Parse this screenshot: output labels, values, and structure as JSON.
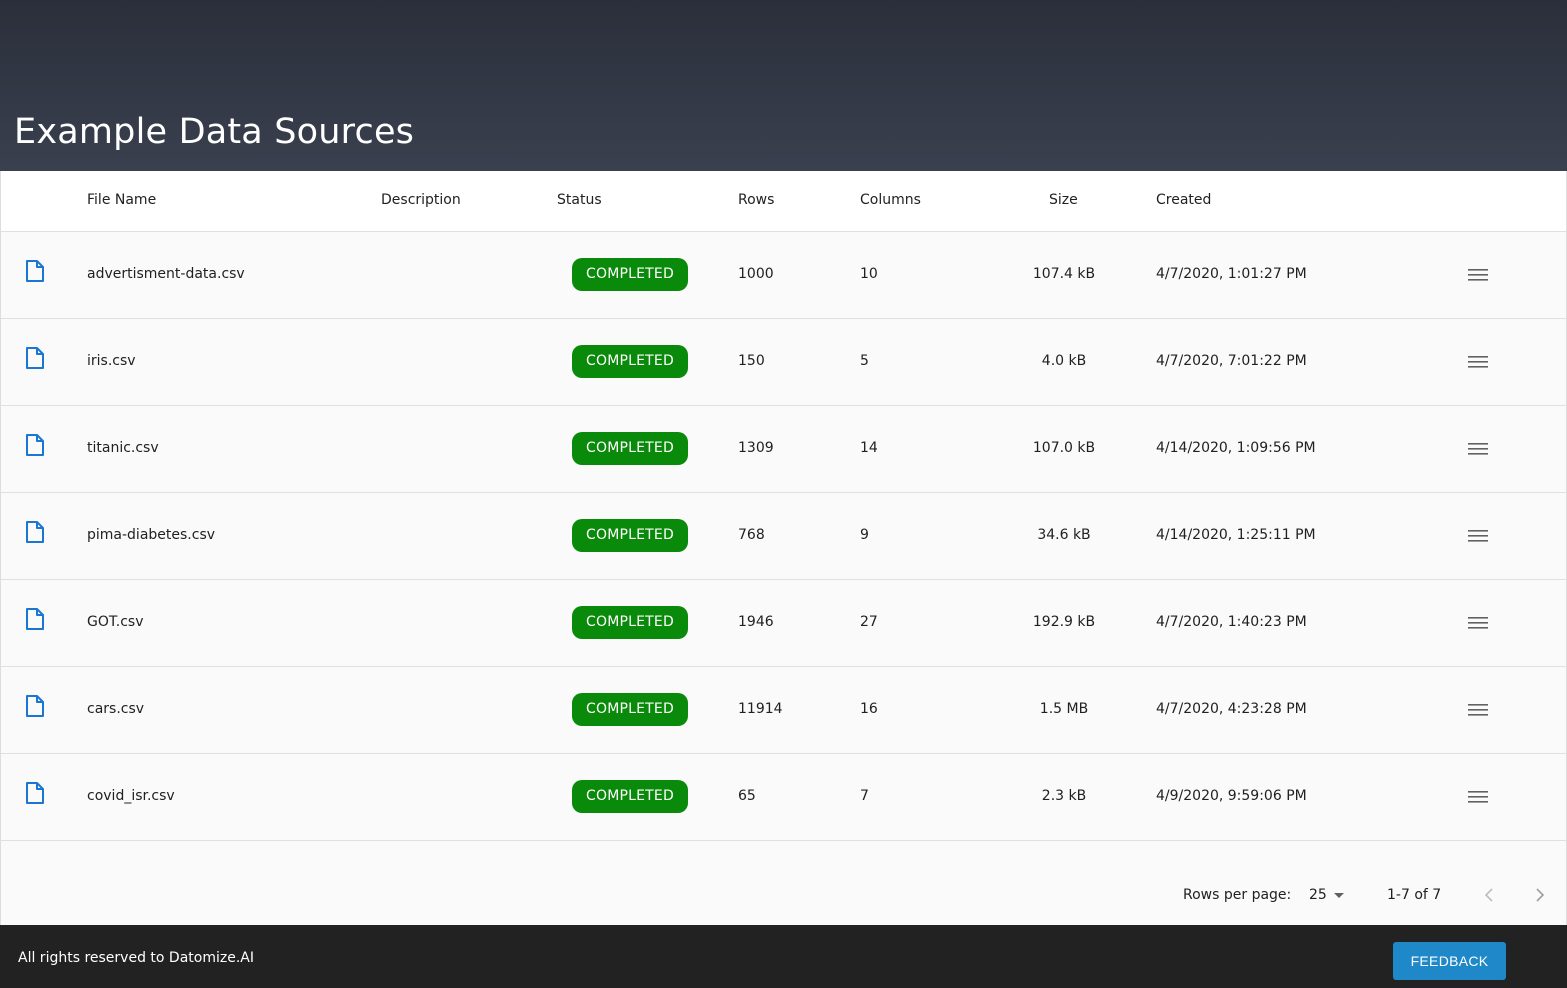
{
  "header": {
    "title": "Example Data Sources"
  },
  "table": {
    "columns": [
      "File Name",
      "Description",
      "Status",
      "Rows",
      "Columns",
      "Size",
      "Created"
    ],
    "rows": [
      {
        "file_name": "advertisment-data.csv",
        "description": "",
        "status": "COMPLETED",
        "rows": "1000",
        "columns": "10",
        "size": "107.4 kB",
        "created": "4/7/2020, 1:01:27 PM"
      },
      {
        "file_name": "iris.csv",
        "description": "",
        "status": "COMPLETED",
        "rows": "150",
        "columns": "5",
        "size": "4.0 kB",
        "created": "4/7/2020, 7:01:22 PM"
      },
      {
        "file_name": "titanic.csv",
        "description": "",
        "status": "COMPLETED",
        "rows": "1309",
        "columns": "14",
        "size": "107.0 kB",
        "created": "4/14/2020, 1:09:56 PM"
      },
      {
        "file_name": "pima-diabetes.csv",
        "description": "",
        "status": "COMPLETED",
        "rows": "768",
        "columns": "9",
        "size": "34.6 kB",
        "created": "4/14/2020, 1:25:11 PM"
      },
      {
        "file_name": "GOT.csv",
        "description": "",
        "status": "COMPLETED",
        "rows": "1946",
        "columns": "27",
        "size": "192.9 kB",
        "created": "4/7/2020, 1:40:23 PM"
      },
      {
        "file_name": "cars.csv",
        "description": "",
        "status": "COMPLETED",
        "rows": "11914",
        "columns": "16",
        "size": "1.5 MB",
        "created": "4/7/2020, 4:23:28 PM"
      },
      {
        "file_name": "covid_isr.csv",
        "description": "",
        "status": "COMPLETED",
        "rows": "65",
        "columns": "7",
        "size": "2.3 kB",
        "created": "4/9/2020, 9:59:06 PM"
      }
    ],
    "row_icon": "file-icon",
    "row_action_icon": "menu-icon"
  },
  "pagination": {
    "rows_per_page_label": "Rows per page:",
    "rows_per_page_value": "25",
    "range_text": "1-7 of 7",
    "prev_icon": "chevron-left-icon",
    "next_icon": "chevron-right-icon"
  },
  "footer": {
    "copyright": "All rights reserved to Datomize.AI",
    "feedback_label": "FEEDBACK"
  },
  "colors": {
    "status_completed": "#0a8a0a",
    "file_icon": "#1976d2",
    "feedback_button": "#1e88c8",
    "header_bg": "#2f3441",
    "footer_bg": "#222222"
  }
}
